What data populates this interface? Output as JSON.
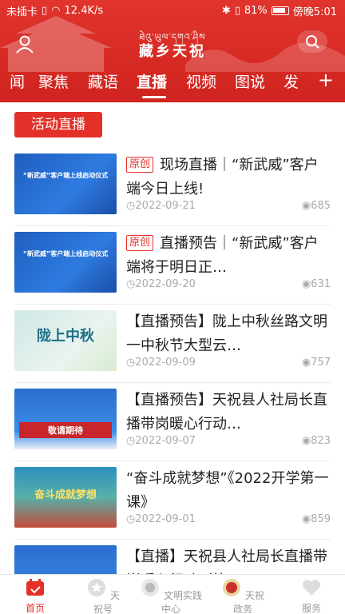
{
  "status": {
    "carrier": "未插卡",
    "speed": "12.4K/s",
    "battery": "81%",
    "time": "傍晚5:01"
  },
  "logo": {
    "tibetan": "ཐེའུ་ཡུལ་དགའ་ཤིས",
    "chinese": "藏乡天祝"
  },
  "tabs": [
    {
      "label": "闻"
    },
    {
      "label": "聚焦"
    },
    {
      "label": "藏语"
    },
    {
      "label": "直播"
    },
    {
      "label": "视频"
    },
    {
      "label": "图说"
    },
    {
      "label": "发"
    }
  ],
  "section": {
    "title": "活动直播"
  },
  "items": [
    {
      "badge": "原创",
      "title": "现场直播｜“新武威”客户端今日上线!",
      "date": "2022-09-21",
      "views": "685",
      "thumb_text": "“新武威”客户端上线启动仪式"
    },
    {
      "badge": "原创",
      "title": "直播预告｜“新武威”客户端将于明日正…",
      "date": "2022-09-20",
      "views": "631",
      "thumb_text": "“新武威”客户端上线启动仪式"
    },
    {
      "badge": "",
      "title": "【直播预告】陇上中秋丝路文明一中秋节大型云…",
      "date": "2022-09-09",
      "views": "757",
      "thumb_text": "陇上中秋"
    },
    {
      "badge": "",
      "title": "【直播预告】天祝县人社局长直播带岗暖心行动…",
      "date": "2022-09-07",
      "views": "823",
      "thumb_text": "敬请期待"
    },
    {
      "badge": "",
      "title": "“奋斗成就梦想”《2022开学第一课》",
      "date": "2022-09-01",
      "views": "859",
      "thumb_text": "奋斗成就梦想"
    },
    {
      "badge": "",
      "title": "【直播】天祝县人社局长直播带岗暖心行动（第…",
      "date": "",
      "views": "",
      "thumb_text": ""
    }
  ],
  "bottom_nav": [
    {
      "label": "首页"
    },
    {
      "label": "天祝号"
    },
    {
      "label": "文明实践中心"
    },
    {
      "label": "天祝政务"
    },
    {
      "label": "服务"
    }
  ],
  "colors": {
    "brand_red": "#e33129"
  }
}
